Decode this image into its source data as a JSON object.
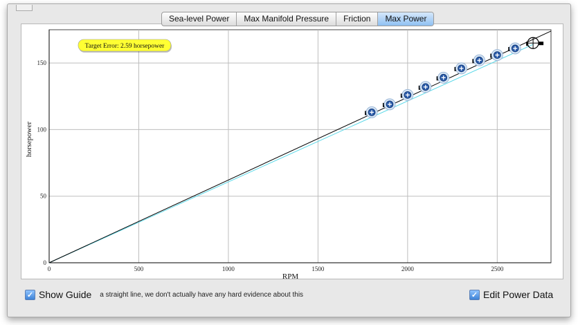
{
  "tabs": [
    {
      "label": "Sea-level Power",
      "active": false
    },
    {
      "label": "Max Manifold Pressure",
      "active": false
    },
    {
      "label": "Friction",
      "active": false
    },
    {
      "label": "Max Power",
      "active": true
    }
  ],
  "annotation": "Target Error: 2.59 horsepower",
  "footer": {
    "show_guide_label": "Show Guide",
    "show_guide_checked": true,
    "guide_note": "a straight line, we don't actually have any hard evidence about this",
    "edit_power_label": "Edit Power Data",
    "edit_power_checked": true
  },
  "colors": {
    "fit_line": "#000000",
    "guide_line": "#5ad8e8",
    "point_fill": "#2a5aa8",
    "annotation_bg": "#ffff33"
  },
  "chart_data": {
    "type": "scatter",
    "xlabel": "RPM",
    "ylabel": "horsepower",
    "xlim": [
      0,
      2800
    ],
    "ylim": [
      0,
      175
    ],
    "x_ticks": [
      0,
      500,
      1000,
      1500,
      2000,
      2500
    ],
    "y_ticks": [
      0,
      50,
      100,
      150
    ],
    "grid": true,
    "series": [
      {
        "kind": "points",
        "x": [
          1800,
          1900,
          2000,
          2100,
          2200,
          2300,
          2400,
          2500,
          2600,
          2700
        ],
        "y": [
          113,
          119,
          126,
          132,
          139,
          146,
          152,
          156,
          161,
          165
        ]
      },
      {
        "kind": "fit_line",
        "x": [
          0,
          2800
        ],
        "y": [
          0,
          174
        ]
      },
      {
        "kind": "guide_line",
        "x": [
          0,
          2700
        ],
        "y": [
          0,
          164
        ]
      }
    ]
  }
}
